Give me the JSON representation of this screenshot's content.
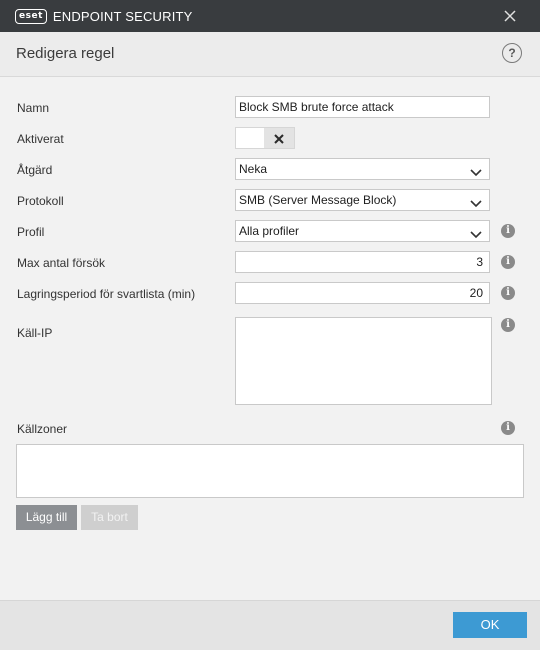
{
  "titlebar": {
    "brand": "eset",
    "product": "ENDPOINT SECURITY"
  },
  "header": {
    "title": "Redigera regel",
    "help": "?"
  },
  "form": {
    "name": {
      "label": "Namn",
      "value": "Block SMB brute force attack"
    },
    "enabled": {
      "label": "Aktiverat",
      "state": false
    },
    "action": {
      "label": "Åtgärd",
      "value": "Neka"
    },
    "protocol": {
      "label": "Protokoll",
      "value": "SMB (Server Message Block)"
    },
    "profile": {
      "label": "Profil",
      "value": "Alla profiler"
    },
    "max_attempts": {
      "label": "Max antal försök",
      "value": "3"
    },
    "retention": {
      "label": "Lagringsperiod för svartlista (min)",
      "value": "20"
    },
    "source_ip": {
      "label": "Käll-IP",
      "value": ""
    },
    "source_zones": {
      "label": "Källzoner"
    }
  },
  "buttons": {
    "add": "Lägg till",
    "remove": "Ta bort",
    "ok": "OK"
  },
  "colors": {
    "titlebar": "#393c3f",
    "ok_button": "#3d9ad3",
    "add_button": "#8c8f93",
    "disabled_button": "#cfcfcf"
  }
}
